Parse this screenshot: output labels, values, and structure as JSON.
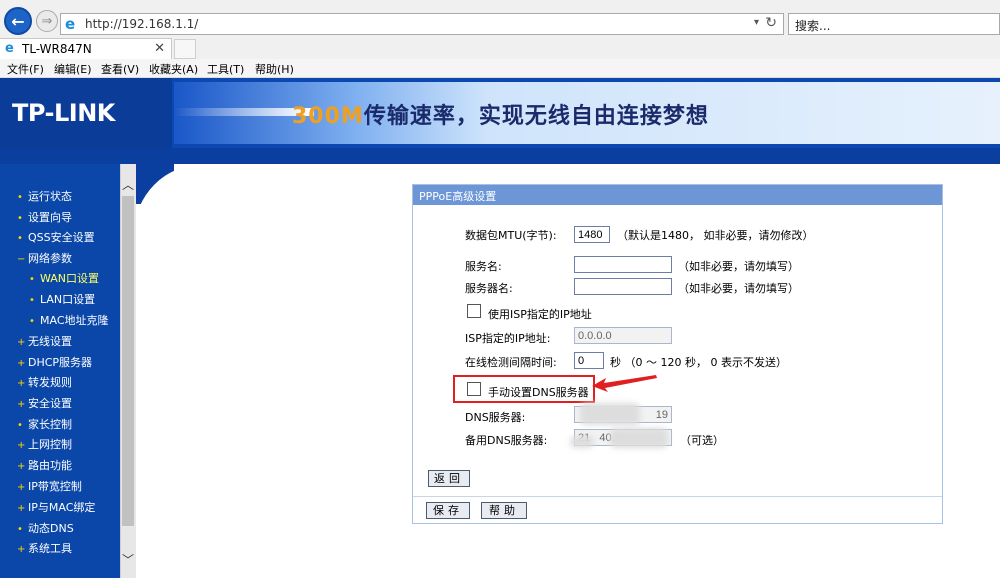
{
  "browser": {
    "url": "http://192.168.1.1/",
    "search_placeholder": "搜索...",
    "tab_title": "TL-WR847N",
    "menu": [
      "文件(F)",
      "编辑(E)",
      "查看(V)",
      "收藏夹(A)",
      "工具(T)",
      "帮助(H)"
    ]
  },
  "banner": {
    "logo": "TP-LINK",
    "slogan_highlight": "300M",
    "slogan_rest": "传输速率，实现无线自由连接梦想"
  },
  "sidebar": {
    "items": [
      {
        "label": "运行状态",
        "marker": "•"
      },
      {
        "label": "设置向导",
        "marker": "•"
      },
      {
        "label": "QSS安全设置",
        "marker": "•"
      },
      {
        "label": "网络参数",
        "marker": "−"
      },
      {
        "label": "WAN口设置",
        "marker": "•"
      },
      {
        "label": "LAN口设置",
        "marker": "•"
      },
      {
        "label": "MAC地址克隆",
        "marker": "•"
      },
      {
        "label": "无线设置",
        "marker": "+"
      },
      {
        "label": "DHCP服务器",
        "marker": "+"
      },
      {
        "label": "转发规则",
        "marker": "+"
      },
      {
        "label": "安全设置",
        "marker": "+"
      },
      {
        "label": "家长控制",
        "marker": "•"
      },
      {
        "label": "上网控制",
        "marker": "+"
      },
      {
        "label": "路由功能",
        "marker": "+"
      },
      {
        "label": "IP带宽控制",
        "marker": "+"
      },
      {
        "label": "IP与MAC绑定",
        "marker": "+"
      },
      {
        "label": "动态DNS",
        "marker": "•"
      },
      {
        "label": "系统工具",
        "marker": "+"
      }
    ],
    "active_item": "WAN口设置"
  },
  "panel": {
    "title": "PPPoE高级设置",
    "mtu_label": "数据包MTU(字节):",
    "mtu_value": "1480",
    "mtu_hint": "（默认是1480， 如非必要，请勿修改）",
    "service_name_label": "服务名:",
    "service_name_value": "",
    "service_name_hint": "（如非必要，请勿填写）",
    "server_name_label": "服务器名:",
    "server_name_value": "",
    "server_name_hint": "（如非必要，请勿填写）",
    "isp_ip_checkbox_label": "使用ISP指定的IP地址",
    "isp_ip_checked": false,
    "isp_ip_label": "ISP指定的IP地址:",
    "isp_ip_value": "0.0.0.0",
    "interval_label": "在线检测间隔时间:",
    "interval_value": "0",
    "interval_hint": "秒 （0 ～ 120 秒， 0 表示不发送）",
    "manual_dns_label": "手动设置DNS服务器",
    "manual_dns_checked": false,
    "dns_label": "DNS服务器:",
    "dns_value": "19",
    "alt_dns_label": "备用DNS服务器:",
    "alt_dns_value": "21   40.1",
    "alt_dns_hint": "（可选）",
    "back_button": "返回",
    "save_button": "保存",
    "help_button": "帮助"
  },
  "colors": {
    "banner_blue": "#0c48b0",
    "sidebar_blue": "#0a47a8",
    "panel_header": "#6c96d6",
    "highlight_red": "#e02020"
  }
}
